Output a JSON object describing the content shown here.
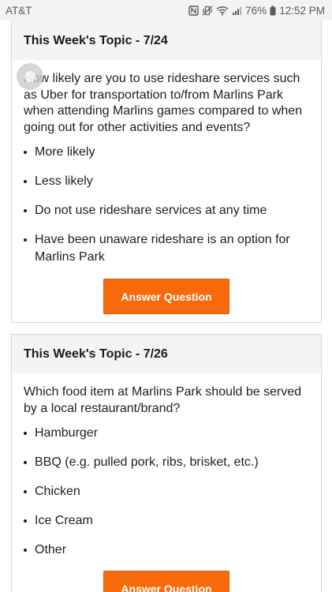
{
  "status_bar": {
    "carrier": "AT&T",
    "battery": "76%",
    "time": "12:52 PM",
    "icons": [
      "nfc-icon",
      "vibrate-icon",
      "wifi-icon",
      "signal-icon",
      "battery-icon"
    ]
  },
  "topics": [
    {
      "header": "This Week's Topic - 7/24",
      "question": "How likely are you to use rideshare services such as Uber for transportation to/from Marlins Park when attending Marlins games compared to when going out for other activities and events?",
      "options": [
        "More likely",
        "Less likely",
        "Do not use rideshare services at any time",
        "Have been unaware rideshare is an option for Marlins Park"
      ],
      "button_label": "Answer Question"
    },
    {
      "header": "This Week's Topic - 7/26",
      "question": "Which food item at Marlins Park should be served by a local restaurant/brand?",
      "options": [
        "Hamburger",
        "BBQ (e.g. pulled pork, ribs, brisket, etc.)",
        "Chicken",
        "Ice Cream",
        "Other"
      ],
      "button_label": "Answer Question"
    }
  ],
  "colors": {
    "button": "#f76a0c",
    "header_bg": "#f4f4f4",
    "status_bg": "#f3f3f3"
  }
}
